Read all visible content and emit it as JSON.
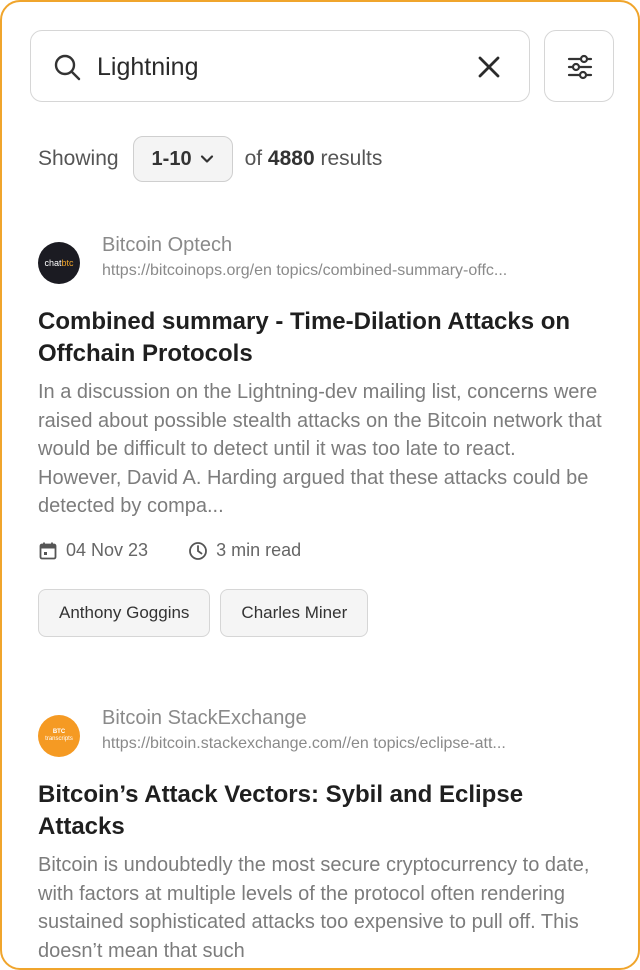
{
  "search": {
    "value": "Lightning"
  },
  "pagination": {
    "showing_label": "Showing",
    "range": "1-10",
    "of_label": "of",
    "total": "4880",
    "results_label": "results"
  },
  "results": [
    {
      "source": "Bitcoin Optech",
      "url": "https://bitcoinops.org/en topics/combined-summary-offc...",
      "logo_text": [
        "chat",
        "btc"
      ],
      "title": "Combined summary - Time-Dilation Attacks on Offchain Protocols",
      "snippet": "In a discussion on the Lightning-dev mailing list, concerns were raised about possible stealth attacks on the Bitcoin network that would be difficult to detect until it was too late to react. However, David A. Harding argued that these attacks could be detected by compa...",
      "date": "04 Nov 23",
      "read_time": "3 min read",
      "tags": [
        "Anthony Goggins",
        "Charles Miner"
      ]
    },
    {
      "source": "Bitcoin StackExchange",
      "url": "https://bitcoin.stackexchange.com//en topics/eclipse-att...",
      "logo_text": [
        "BTC",
        "transcripts"
      ],
      "title": "Bitcoin’s Attack Vectors: Sybil and Eclipse Attacks",
      "snippet": "Bitcoin is undoubtedly the most secure cryptocurrency to date, with factors at multiple levels of the protocol often rendering sustained sophisticated attacks too expensive to pull off. This doesn’t mean that such"
    }
  ],
  "colors": {
    "frame_border": "#f0a52c",
    "orange_logo": "#f59a23",
    "dark_logo": "#1b1b22"
  }
}
